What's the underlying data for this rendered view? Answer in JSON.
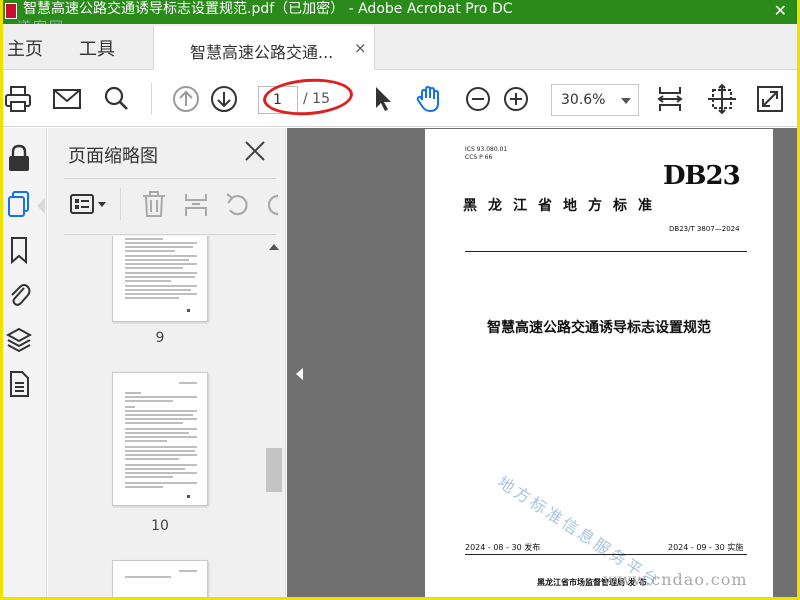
{
  "window": {
    "title": "智慧高速公路交通诱导标志设置规范.pdf（已加密） - Adobe Acrobat Pro DC",
    "close_glyph": "✕",
    "watermark": "道客网"
  },
  "tabs": {
    "home": "主页",
    "tools": "工具",
    "document": "智慧高速公路交通...",
    "close_glyph": "×"
  },
  "toolbar": {
    "current_page": "1",
    "total_pages": "/ 15",
    "zoom": "30.6%"
  },
  "thumbnails_panel": {
    "title": "页面缩略图",
    "pages": [
      {
        "number": "9"
      },
      {
        "number": "10"
      }
    ]
  },
  "document_page": {
    "ics": "ICS  93.080.01",
    "ccs": "CCS  P 66",
    "logo": "DB23",
    "region": "黑龙江省地方标准",
    "standard_number": "DB23/T 3807—2024",
    "title": "智慧高速公路交通诱导标志设置规范",
    "watermark": "地方标准信息服务平台",
    "issue_date": "2024 - 08 - 30 发布",
    "implement_date": "2024 - 09 - 30 实施",
    "issuer": "黑龙江省市场监督管理局    发 布"
  },
  "site_watermark": "www.cndao.com",
  "colors": {
    "title_bar": "#2a8a1a",
    "accent_blue": "#1473e6",
    "annotation_red": "#e02020",
    "doc_background": "#707070"
  }
}
